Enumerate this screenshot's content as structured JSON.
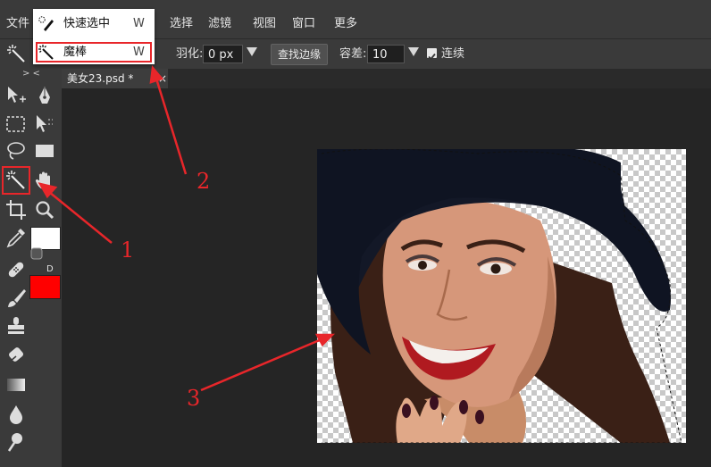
{
  "menubar": {
    "items": [
      "文件",
      "选择",
      "滤镜",
      "视图",
      "窗口",
      "更多"
    ]
  },
  "tool_dropdown": {
    "items": [
      {
        "label": "快速选中",
        "shortcut": "W"
      },
      {
        "label": "魔棒",
        "shortcut": "W"
      }
    ]
  },
  "options": {
    "feather_label": "羽化:",
    "feather_value": "0 px",
    "find_edges_label": "查找边缘",
    "tolerance_label": "容差:",
    "tolerance_value": "10",
    "contiguous_label": "连续",
    "contiguous_checked": true
  },
  "toolbar": {
    "collapse_label": "> <",
    "default_colors_label": "D",
    "foreground_color": "#ffffff",
    "background_color": "#ff0000",
    "tools": [
      "move-icon",
      "pen-icon",
      "marquee-icon",
      "path-select-icon",
      "lasso-icon",
      "rectangle-shape-icon",
      "magic-wand-icon",
      "hand-icon",
      "crop-icon",
      "zoom-icon",
      "eyedropper-icon",
      "healing-brush-icon",
      "brush-icon",
      "clone-stamp-icon",
      "eraser-icon",
      "gradient-icon",
      "blur-icon",
      "dodge-icon"
    ]
  },
  "document": {
    "tab_title": "美女23.psd *",
    "close_label": "×"
  },
  "annotations": [
    "1",
    "2",
    "3"
  ],
  "colors": {
    "highlight": "#e8262a",
    "panel": "#3a3a3a",
    "workspace": "#252525"
  }
}
